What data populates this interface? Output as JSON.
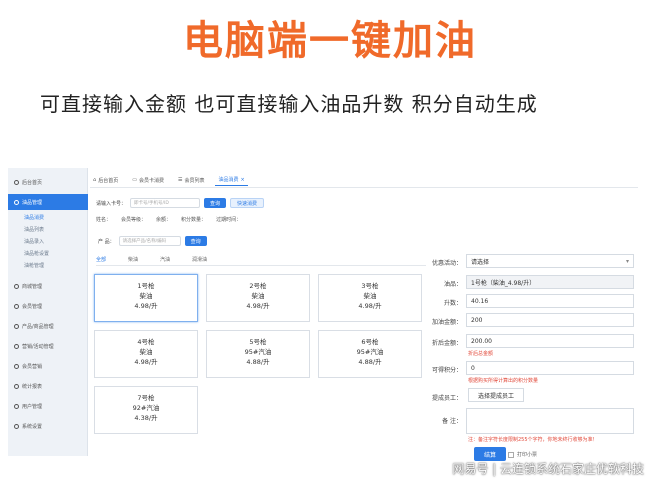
{
  "headline": "电脑端一键加油",
  "subline": "可直接输入金额  也可直接输入油品升数  积分自动生成",
  "sidebar": {
    "items": [
      {
        "label": "后台首页"
      },
      {
        "label": "油品管理"
      },
      {
        "label": "商城管理"
      },
      {
        "label": "会员管理"
      },
      {
        "label": "产品/商品管理"
      },
      {
        "label": "营销/活动管理"
      },
      {
        "label": "会员营销"
      },
      {
        "label": "统计报表"
      },
      {
        "label": "用户管理"
      },
      {
        "label": "系统设置"
      }
    ],
    "subitems": [
      "油品消费",
      "油品列表",
      "油品录入",
      "油品枪设置",
      "油枪管理"
    ]
  },
  "tabs": [
    {
      "label": "后台首页"
    },
    {
      "label": "会员卡消费"
    },
    {
      "label": "会员列表"
    },
    {
      "label": "油品消费"
    }
  ],
  "member": {
    "label": "请输入卡号：",
    "placeholder": "即卡号/手机号/ID",
    "query_button": "查询",
    "quick_button": "快速消费"
  },
  "info_fields": [
    "姓名：",
    "会员等级：",
    "余额：",
    "积分数量：",
    "过期时间："
  ],
  "product": {
    "label": "产  品：",
    "placeholder": "请选择产品/名称/编码",
    "search_button": "查询"
  },
  "fuel_tabs": [
    {
      "label": "全部",
      "active": true
    },
    {
      "label": "柴油",
      "active": false
    },
    {
      "label": "汽油",
      "active": false
    },
    {
      "label": "润滑油",
      "active": false
    }
  ],
  "pumps": [
    {
      "gun": "1号枪",
      "fuel": "柴油",
      "price": "4.98/升",
      "selected": true
    },
    {
      "gun": "2号枪",
      "fuel": "柴油",
      "price": "4.98/升",
      "selected": false
    },
    {
      "gun": "3号枪",
      "fuel": "柴油",
      "price": "4.98/升",
      "selected": false
    },
    {
      "gun": "4号枪",
      "fuel": "柴油",
      "price": "4.98/升",
      "selected": false
    },
    {
      "gun": "5号枪",
      "fuel": "95#汽油",
      "price": "4.88/升",
      "selected": false
    },
    {
      "gun": "6号枪",
      "fuel": "95#汽油",
      "price": "4.88/升",
      "selected": false
    },
    {
      "gun": "7号枪",
      "fuel": "92#汽油",
      "price": "4.38/升",
      "selected": false
    }
  ],
  "form": {
    "promo_label": "优惠活动：",
    "promo_value": "请选择",
    "fuel_label": "油品：",
    "fuel_value": "1号枪（柴油_4.98/升）",
    "liters_label": "升数：",
    "liters_value": "40.16",
    "amount_label": "加油金额：",
    "amount_value": "200",
    "after_label": "折后金额：",
    "after_value": "200.00",
    "after_hint": "折后总金额",
    "points_label": "可得积分：",
    "points_value": "0",
    "points_hint": "根据购买所得计算出的积分数量",
    "staff_label": "提成员工：",
    "staff_button": "选择提成员工",
    "note_label": "备   注：",
    "note_hint": "注：备注字符长度限制255个字符，你地未终行收够为准！",
    "submit": "结算",
    "print_label": "打印小票"
  },
  "watermark": "网易号 | 云连锁系统石家庄优软科技",
  "colors": {
    "headline": "#f06a2a",
    "accent": "#2c7be5",
    "hint": "#e24a3b"
  }
}
